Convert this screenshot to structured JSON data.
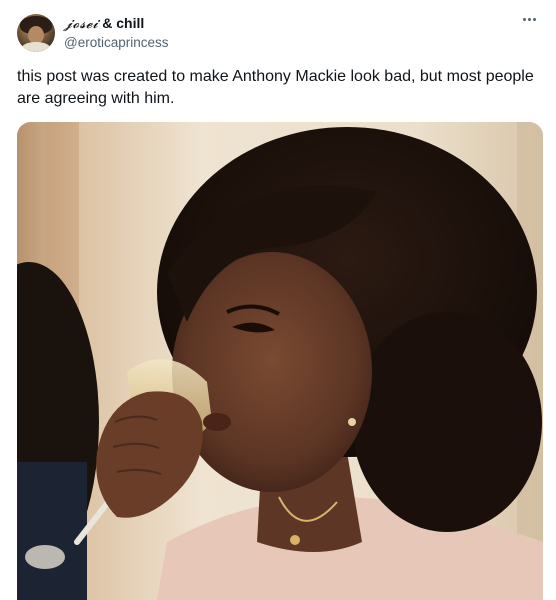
{
  "author": {
    "display_name_fancy": "𝓳𝓸𝓼𝓮𝓲",
    "display_name_rest": "& chill",
    "handle": "@eroticaprincess",
    "avatar_icon": "profile-avatar"
  },
  "more_icon": "more-horizontal-icon",
  "tweet": {
    "text": "this post was created to make Anthony Mackie look bad, but most people are agreeing with him."
  },
  "media": {
    "description_icon": "gif-thumbnail"
  },
  "colors": {
    "text_primary": "#0f1419",
    "text_secondary": "#536471",
    "background": "#ffffff"
  }
}
